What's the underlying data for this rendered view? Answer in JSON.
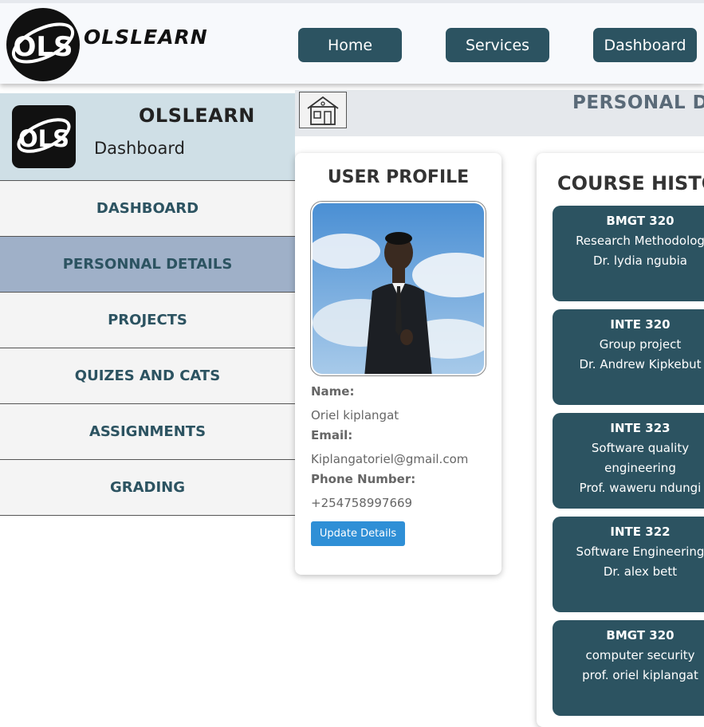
{
  "header": {
    "brand": "OLSLEARN",
    "logo_text": "OLS",
    "nav": [
      {
        "label": "Home"
      },
      {
        "label": "Services"
      },
      {
        "label": "Dashboard"
      }
    ]
  },
  "sidebar": {
    "title": "OLSLEARN",
    "subtitle": "Dashboard",
    "logo_text": "OLS",
    "items": [
      {
        "label": "DASHBOARD"
      },
      {
        "label": "PERSONNAL DETAILS",
        "active": true
      },
      {
        "label": "PROJECTS"
      },
      {
        "label": "QUIZES AND CATS"
      },
      {
        "label": "ASSIGNMENTS"
      },
      {
        "label": "GRADING"
      }
    ]
  },
  "banner": {
    "icon": "house-icon",
    "title": "PERSONAL DE"
  },
  "profile": {
    "title": "USER PROFILE",
    "name_label": "Name:",
    "name": "Oriel kiplangat",
    "email_label": "Email:",
    "email": "Kiplangatoriel@gmail.com",
    "phone_label": "Phone Number:",
    "phone": "+254758997669",
    "update_button": "Update Details"
  },
  "history": {
    "title": "COURSE HISTOR",
    "courses": [
      {
        "code": "BMGT 320",
        "lines": [
          "Research Methodolog",
          "Dr. lydia ngubia"
        ]
      },
      {
        "code": "INTE 320",
        "lines": [
          "Group project",
          "Dr. Andrew Kipkebut"
        ]
      },
      {
        "code": "INTE 323",
        "lines": [
          "Software quality",
          "engineering",
          "Prof. waweru ndungi"
        ]
      },
      {
        "code": "INTE 322",
        "lines": [
          "Software Engineering",
          "Dr. alex bett"
        ]
      },
      {
        "code": "BMGT 320",
        "lines": [
          "computer security",
          "prof. oriel kiplangat"
        ]
      }
    ]
  },
  "colors": {
    "primary": "#2c5361",
    "sidebar_active": "#9fb0c8",
    "sidebar_header": "#cfdfe6",
    "update_button": "#2f8fd6"
  }
}
